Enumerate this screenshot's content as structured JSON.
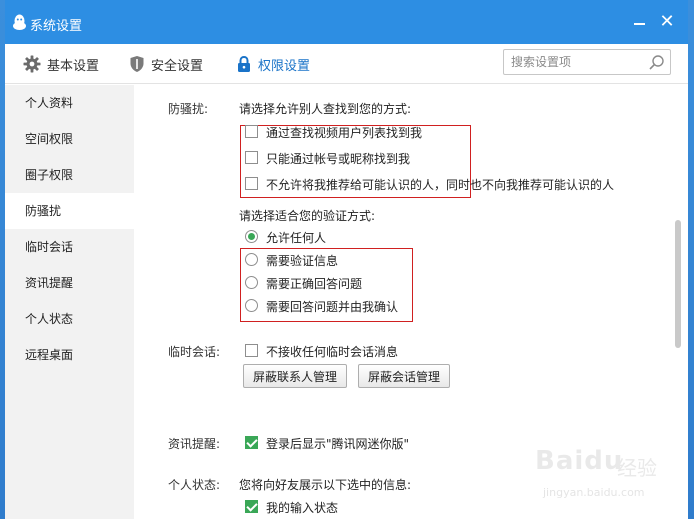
{
  "window": {
    "title": "系统设置",
    "minimize_icon": "minimize-icon",
    "close_icon": "close-icon",
    "close_glyph": "✕"
  },
  "toolbar": {
    "tabs": [
      {
        "label": "基本设置",
        "icon": "gear-icon"
      },
      {
        "label": "安全设置",
        "icon": "shield-icon"
      },
      {
        "label": "权限设置",
        "icon": "lock-icon"
      }
    ],
    "active_tab": "权限设置",
    "search_placeholder": "搜索设置项",
    "accent_color": "#2d8ee3"
  },
  "sidebar": {
    "items": [
      {
        "label": "个人资料"
      },
      {
        "label": "空间权限"
      },
      {
        "label": "圈子权限"
      },
      {
        "label": "防骚扰"
      },
      {
        "label": "临时会话"
      },
      {
        "label": "资讯提醒"
      },
      {
        "label": "个人状态"
      },
      {
        "label": "远程桌面"
      }
    ],
    "active_item": "防骚扰"
  },
  "main": {
    "anti_harass": {
      "label": "防骚扰:",
      "find_prompt": "请选择允许别人查找到您的方式:",
      "find_options": [
        {
          "label": "通过查找视频用户列表找到我",
          "checked": false
        },
        {
          "label": "只能通过帐号或昵称找到我",
          "checked": false
        },
        {
          "label": "不允许将我推荐给可能认识的人，同时也不向我推荐可能认识的人",
          "checked": false
        }
      ],
      "verify_prompt": "请选择适合您的验证方式:",
      "verify_options": [
        {
          "label": "允许任何人",
          "selected": true
        },
        {
          "label": "需要验证信息",
          "selected": false
        },
        {
          "label": "需要正确回答问题",
          "selected": false
        },
        {
          "label": "需要回答问题并由我确认",
          "selected": false
        }
      ]
    },
    "temp_session": {
      "label": "临时会话:",
      "option": {
        "label": "不接收任何临时会话消息",
        "checked": false
      },
      "buttons": [
        "屏蔽联系人管理",
        "屏蔽会话管理"
      ]
    },
    "news": {
      "label": "资讯提醒:",
      "option": {
        "label": "登录后显示\"腾讯网迷你版\"",
        "checked": true
      }
    },
    "status": {
      "label": "个人状态:",
      "prompt": "您将向好友展示以下选中的信息:",
      "option": {
        "label": "我的输入状态",
        "checked": true
      }
    },
    "highlight_color": "#d02020",
    "check_color": "#3aa757"
  },
  "watermark": {
    "brand": "Baidu",
    "product": "经验",
    "url": "jingyan.baidu.com"
  }
}
